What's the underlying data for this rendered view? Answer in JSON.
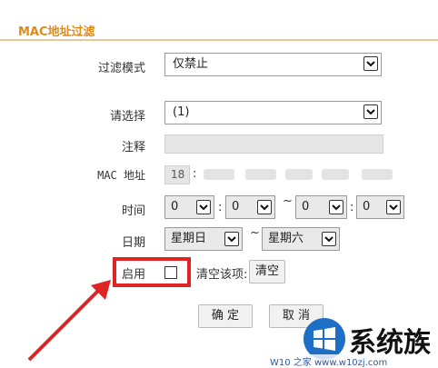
{
  "header": {
    "title": "MAC地址过滤"
  },
  "form": {
    "filter_mode": {
      "label": "过滤模式",
      "value": "仅禁止"
    },
    "select": {
      "label": "请选择",
      "value": "(1)"
    },
    "comment": {
      "label": "注释",
      "value": ""
    },
    "mac": {
      "label": "MAC 地址",
      "first_octet": "18",
      "separator": ":"
    },
    "time": {
      "label": "时间",
      "start_hour": "0",
      "start_minute": "0",
      "end_hour": "0",
      "end_minute": "0",
      "colon": ":",
      "range_sep": "~"
    },
    "date": {
      "label": "日期",
      "start_day": "星期日",
      "end_day": "星期六",
      "range_sep": "~"
    },
    "enable": {
      "label": "启用",
      "checked": false
    },
    "clear": {
      "label": "清空该项:",
      "button": "清空"
    }
  },
  "actions": {
    "confirm": "确 定",
    "cancel": "取 消"
  },
  "watermark": {
    "brand": "系统族",
    "url": "W10 之家 www.w10zj.com"
  },
  "colors": {
    "title": "#e08a1a",
    "highlight": "#e02424",
    "logo_blue": "#1d6fc6"
  },
  "icons": [
    "chevron-down-icon",
    "windows-logo-icon",
    "red-arrow-icon"
  ]
}
